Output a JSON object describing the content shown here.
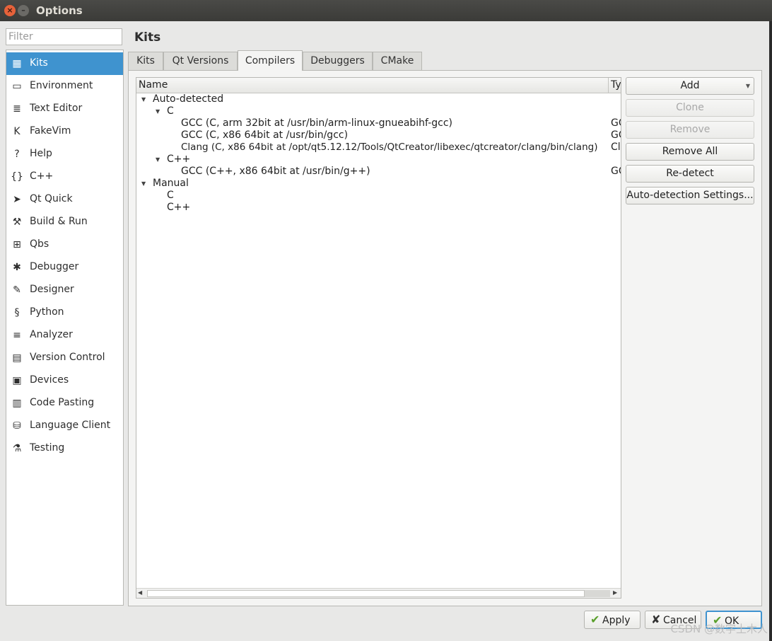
{
  "window": {
    "title": "Options",
    "close_glyph": "×",
    "minimize_glyph": "–"
  },
  "filter": {
    "placeholder": "Filter",
    "value": ""
  },
  "categories": [
    {
      "label": "Kits",
      "icon": "kits-icon",
      "glyph": "▦",
      "selected": true
    },
    {
      "label": "Environment",
      "icon": "monitor-icon",
      "glyph": "▭"
    },
    {
      "label": "Text Editor",
      "icon": "text-editor-icon",
      "glyph": "≣"
    },
    {
      "label": "FakeVim",
      "icon": "fakevim-icon",
      "glyph": "K"
    },
    {
      "label": "Help",
      "icon": "help-icon",
      "glyph": "?"
    },
    {
      "label": "C++",
      "icon": "braces-icon",
      "glyph": "{}"
    },
    {
      "label": "Qt Quick",
      "icon": "paper-plane-icon",
      "glyph": "➤"
    },
    {
      "label": "Build & Run",
      "icon": "hammer-icon",
      "glyph": "⚒"
    },
    {
      "label": "Qbs",
      "icon": "qbs-icon",
      "glyph": "⊞"
    },
    {
      "label": "Debugger",
      "icon": "bug-icon",
      "glyph": "✱"
    },
    {
      "label": "Designer",
      "icon": "pencil-icon",
      "glyph": "✎"
    },
    {
      "label": "Python",
      "icon": "python-icon",
      "glyph": "§"
    },
    {
      "label": "Analyzer",
      "icon": "analyzer-icon",
      "glyph": "≡"
    },
    {
      "label": "Version Control",
      "icon": "version-control-icon",
      "glyph": "▤"
    },
    {
      "label": "Devices",
      "icon": "devices-icon",
      "glyph": "▣"
    },
    {
      "label": "Code Pasting",
      "icon": "clipboard-icon",
      "glyph": "▥"
    },
    {
      "label": "Language Client",
      "icon": "language-client-icon",
      "glyph": "⛁"
    },
    {
      "label": "Testing",
      "icon": "flask-icon",
      "glyph": "⚗"
    }
  ],
  "page": {
    "title": "Kits"
  },
  "tabs": [
    {
      "label": "Kits"
    },
    {
      "label": "Qt Versions"
    },
    {
      "label": "Compilers",
      "active": true
    },
    {
      "label": "Debuggers"
    },
    {
      "label": "CMake"
    }
  ],
  "tree": {
    "headers": {
      "name": "Name",
      "type": "Ty"
    },
    "rows": [
      {
        "text": "Auto-detected",
        "type": "",
        "expanded": true
      },
      {
        "text": "C",
        "type": "",
        "expanded": true
      },
      {
        "text": "GCC (C, arm 32bit at /usr/bin/arm-linux-gnueabihf-gcc)",
        "type": "GC"
      },
      {
        "text": "GCC (C, x86 64bit at /usr/bin/gcc)",
        "type": "GC"
      },
      {
        "text": "Clang (C, x86 64bit at /opt/qt5.12.12/Tools/QtCreator/libexec/qtcreator/clang/bin/clang)",
        "type": "Cl"
      },
      {
        "text": "C++",
        "type": "",
        "expanded": true
      },
      {
        "text": "GCC (C++, x86 64bit at /usr/bin/g++)",
        "type": "GC"
      },
      {
        "text": "Manual",
        "type": "",
        "expanded": true
      },
      {
        "text": "C",
        "type": ""
      },
      {
        "text": "C++",
        "type": ""
      }
    ],
    "arrow_glyph": "▼",
    "scroll_left_glyph": "◀",
    "scroll_right_glyph": "▶"
  },
  "side_buttons": [
    {
      "label": "Add",
      "enabled": true,
      "dropdown_glyph": "▼"
    },
    {
      "label": "Clone",
      "enabled": false
    },
    {
      "label": "Remove",
      "enabled": false
    },
    {
      "label": "Remove All",
      "enabled": true
    },
    {
      "label": "Re-detect",
      "enabled": true
    },
    {
      "label": "Auto-detection Settings...",
      "enabled": true
    }
  ],
  "bottom_buttons": {
    "apply": {
      "label": "Apply",
      "glyph": "✔"
    },
    "cancel": {
      "label": "Cancel",
      "glyph": "✘"
    },
    "ok": {
      "label": "OK",
      "glyph": "✔"
    }
  },
  "watermark": "CSDN @数字土木人"
}
